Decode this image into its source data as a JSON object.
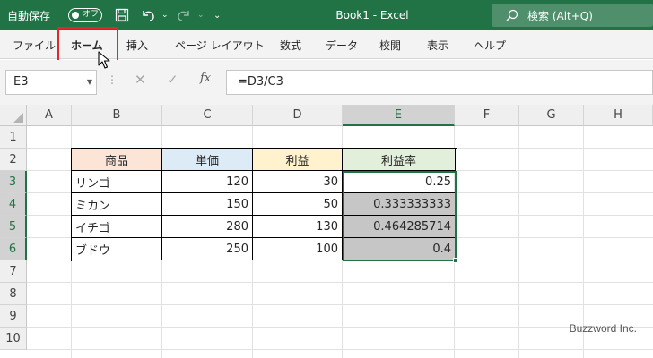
{
  "titlebar": {
    "autosave_label": "自動保存",
    "autosave_state": "オフ",
    "doc_title": "Book1  -  Excel",
    "search_placeholder": "検索 (Alt+Q)"
  },
  "ribbon": {
    "tabs": [
      "ファイル",
      "ホーム",
      "挿入",
      "ページ レイアウト",
      "数式",
      "データ",
      "校閲",
      "表示",
      "ヘルプ"
    ],
    "active_tab": "ホーム"
  },
  "formula_bar": {
    "name_box": "E3",
    "formula": "=D3/C3"
  },
  "columns": [
    "A",
    "B",
    "C",
    "D",
    "E",
    "F",
    "G",
    "H"
  ],
  "rows": [
    "1",
    "2",
    "3",
    "4",
    "5",
    "6",
    "7",
    "8",
    "9",
    "10"
  ],
  "table": {
    "headers": [
      "商品",
      "単価",
      "利益",
      "利益率"
    ],
    "header_colors": [
      "#fce4d6",
      "#ddebf7",
      "#fff2cc",
      "#e2efda"
    ],
    "rows": [
      [
        "リンゴ",
        "120",
        "30",
        "0.25"
      ],
      [
        "ミカン",
        "150",
        "50",
        "0.333333333"
      ],
      [
        "イチゴ",
        "280",
        "130",
        "0.464285714"
      ],
      [
        "ブドウ",
        "250",
        "100",
        "0.4"
      ]
    ]
  },
  "watermark": "Buzzword Inc."
}
